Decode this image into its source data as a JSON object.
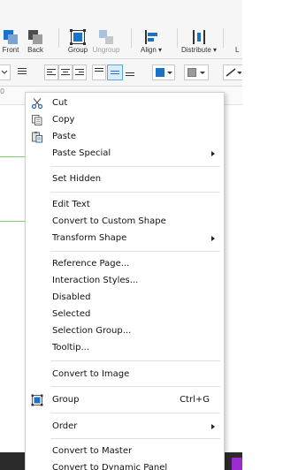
{
  "toolbar": {
    "buttons": [
      {
        "label": "Front",
        "icon": "bring-to-front-icon",
        "enabled": true
      },
      {
        "label": "Back",
        "icon": "send-to-back-icon",
        "enabled": true
      },
      {
        "label": "Group",
        "icon": "group-icon",
        "enabled": true
      },
      {
        "label": "Ungroup",
        "icon": "ungroup-icon",
        "enabled": false
      },
      {
        "label": "Align",
        "icon": "align-icon",
        "enabled": true,
        "dropdown": true
      },
      {
        "label": "Distribute",
        "icon": "distribute-icon",
        "enabled": true,
        "dropdown": true
      }
    ],
    "cut_off_label": "L",
    "align_label": "Align ▾",
    "distribute_label": "Distribute ▾"
  },
  "ruler": {
    "tick_label": "0"
  },
  "context_menu": {
    "items": [
      {
        "id": "cut",
        "label": "Cut",
        "icon": "scissors-icon"
      },
      {
        "id": "copy",
        "label": "Copy",
        "icon": "copy-icon"
      },
      {
        "id": "paste",
        "label": "Paste",
        "icon": "paste-icon"
      },
      {
        "id": "paste_special",
        "label": "Paste Special",
        "submenu": true
      },
      {
        "id": "set_hidden",
        "label": "Set Hidden"
      },
      {
        "id": "edit_text",
        "label": "Edit Text"
      },
      {
        "id": "convert_custom_shape",
        "label": "Convert to Custom Shape"
      },
      {
        "id": "transform_shape",
        "label": "Transform Shape",
        "submenu": true
      },
      {
        "id": "reference_page",
        "label": "Reference Page..."
      },
      {
        "id": "interaction_styles",
        "label": "Interaction Styles..."
      },
      {
        "id": "disabled",
        "label": "Disabled"
      },
      {
        "id": "selected",
        "label": "Selected"
      },
      {
        "id": "selection_group",
        "label": "Selection Group..."
      },
      {
        "id": "tooltip",
        "label": "Tooltip..."
      },
      {
        "id": "convert_image",
        "label": "Convert to Image"
      },
      {
        "id": "group",
        "label": "Group",
        "icon": "group-icon",
        "shortcut": "Ctrl+G"
      },
      {
        "id": "order",
        "label": "Order",
        "submenu": true
      },
      {
        "id": "convert_master",
        "label": "Convert to Master"
      },
      {
        "id": "convert_dynamic_panel",
        "label": "Convert to Dynamic Panel"
      }
    ]
  },
  "colors": {
    "accent_blue": "#1a73c9",
    "canvas_green": "#7ad36b",
    "taskbar_accent": "#9b2bd1"
  }
}
